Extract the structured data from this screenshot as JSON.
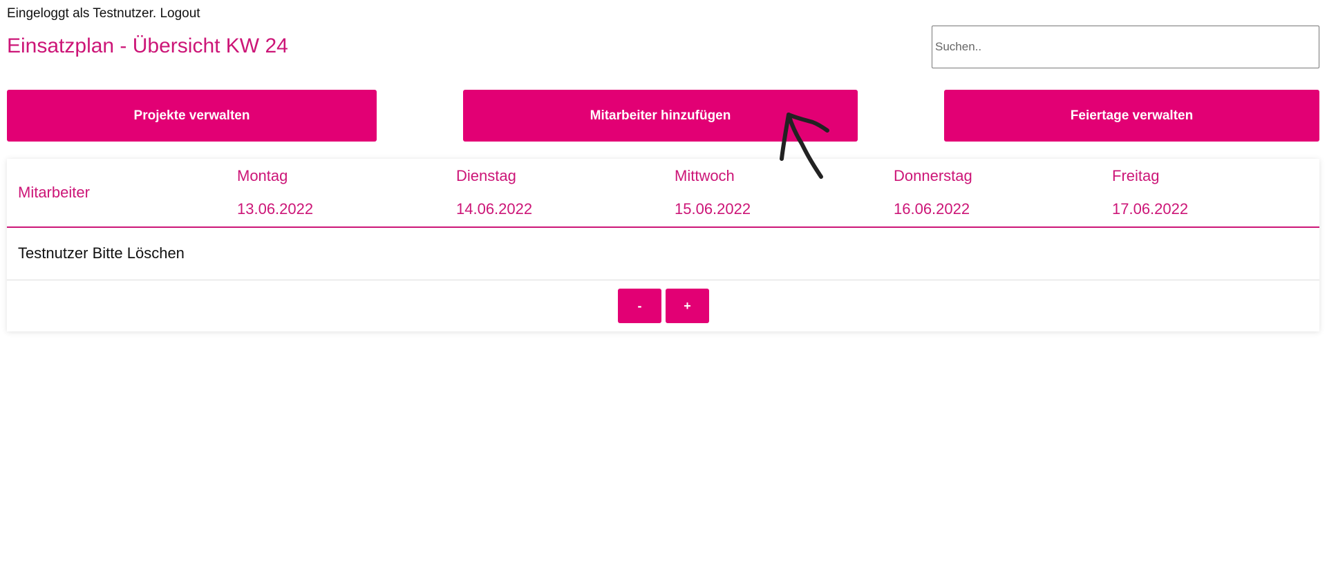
{
  "header": {
    "login_status": "Eingeloggt als Testnutzer.",
    "logout_label": "Logout",
    "title": "Einsatzplan - Übersicht KW 24"
  },
  "search": {
    "placeholder": "Suchen.."
  },
  "actions": {
    "projects_label": "Projekte verwalten",
    "add_employee_label": "Mitarbeiter hinzufügen",
    "holidays_label": "Feiertage verwalten"
  },
  "table": {
    "employee_header": "Mitarbeiter",
    "days": [
      {
        "name": "Montag",
        "date": "13.06.2022"
      },
      {
        "name": "Dienstag",
        "date": "14.06.2022"
      },
      {
        "name": "Mittwoch",
        "date": "15.06.2022"
      },
      {
        "name": "Donnerstag",
        "date": "16.06.2022"
      },
      {
        "name": "Freitag",
        "date": "17.06.2022"
      }
    ],
    "rows": [
      {
        "employee": "Testnutzer Bitte Löschen"
      }
    ]
  },
  "pager": {
    "minus_label": "-",
    "plus_label": "+"
  },
  "colors": {
    "accent": "#e20074",
    "accent_text": "#cc1577",
    "annotation": "#222222"
  },
  "annotations": {
    "hand_drawn_arrow_icon": "arrow-up-icon"
  }
}
